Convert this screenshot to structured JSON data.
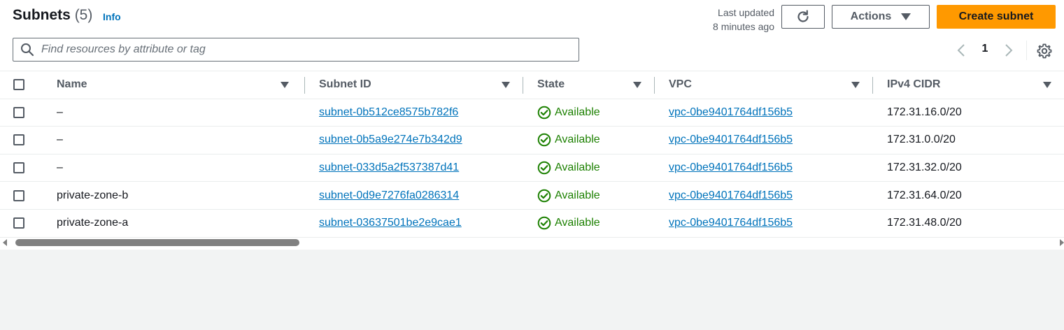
{
  "header": {
    "title": "Subnets",
    "count": "(5)",
    "info_label": "Info",
    "last_updated_line1": "Last updated",
    "last_updated_line2": "8 minutes ago",
    "actions_label": "Actions",
    "create_label": "Create subnet"
  },
  "search": {
    "placeholder": "Find resources by attribute or tag",
    "value": ""
  },
  "pagination": {
    "current_page": "1"
  },
  "table": {
    "columns": [
      "Name",
      "Subnet ID",
      "State",
      "VPC",
      "IPv4 CIDR"
    ],
    "rows": [
      {
        "name": "–",
        "subnet_id": "subnet-0b512ce8575b782f6",
        "state": "Available",
        "vpc": "vpc-0be9401764df156b5",
        "cidr": "172.31.16.0/20"
      },
      {
        "name": "–",
        "subnet_id": "subnet-0b5a9e274e7b342d9",
        "state": "Available",
        "vpc": "vpc-0be9401764df156b5",
        "cidr": "172.31.0.0/20"
      },
      {
        "name": "–",
        "subnet_id": "subnet-033d5a2f537387d41",
        "state": "Available",
        "vpc": "vpc-0be9401764df156b5",
        "cidr": "172.31.32.0/20"
      },
      {
        "name": "private-zone-b",
        "subnet_id": "subnet-0d9e7276fa0286314",
        "state": "Available",
        "vpc": "vpc-0be9401764df156b5",
        "cidr": "172.31.64.0/20"
      },
      {
        "name": "private-zone-a",
        "subnet_id": "subnet-03637501be2e9cae1",
        "state": "Available",
        "vpc": "vpc-0be9401764df156b5",
        "cidr": "172.31.48.0/20"
      }
    ]
  },
  "icons": {
    "refresh": "refresh-icon",
    "search": "search-icon",
    "settings": "gear-icon",
    "status": "check-circle-icon"
  },
  "colors": {
    "primary": "#ff9900",
    "link": "#0073bb",
    "success": "#1d8102"
  }
}
